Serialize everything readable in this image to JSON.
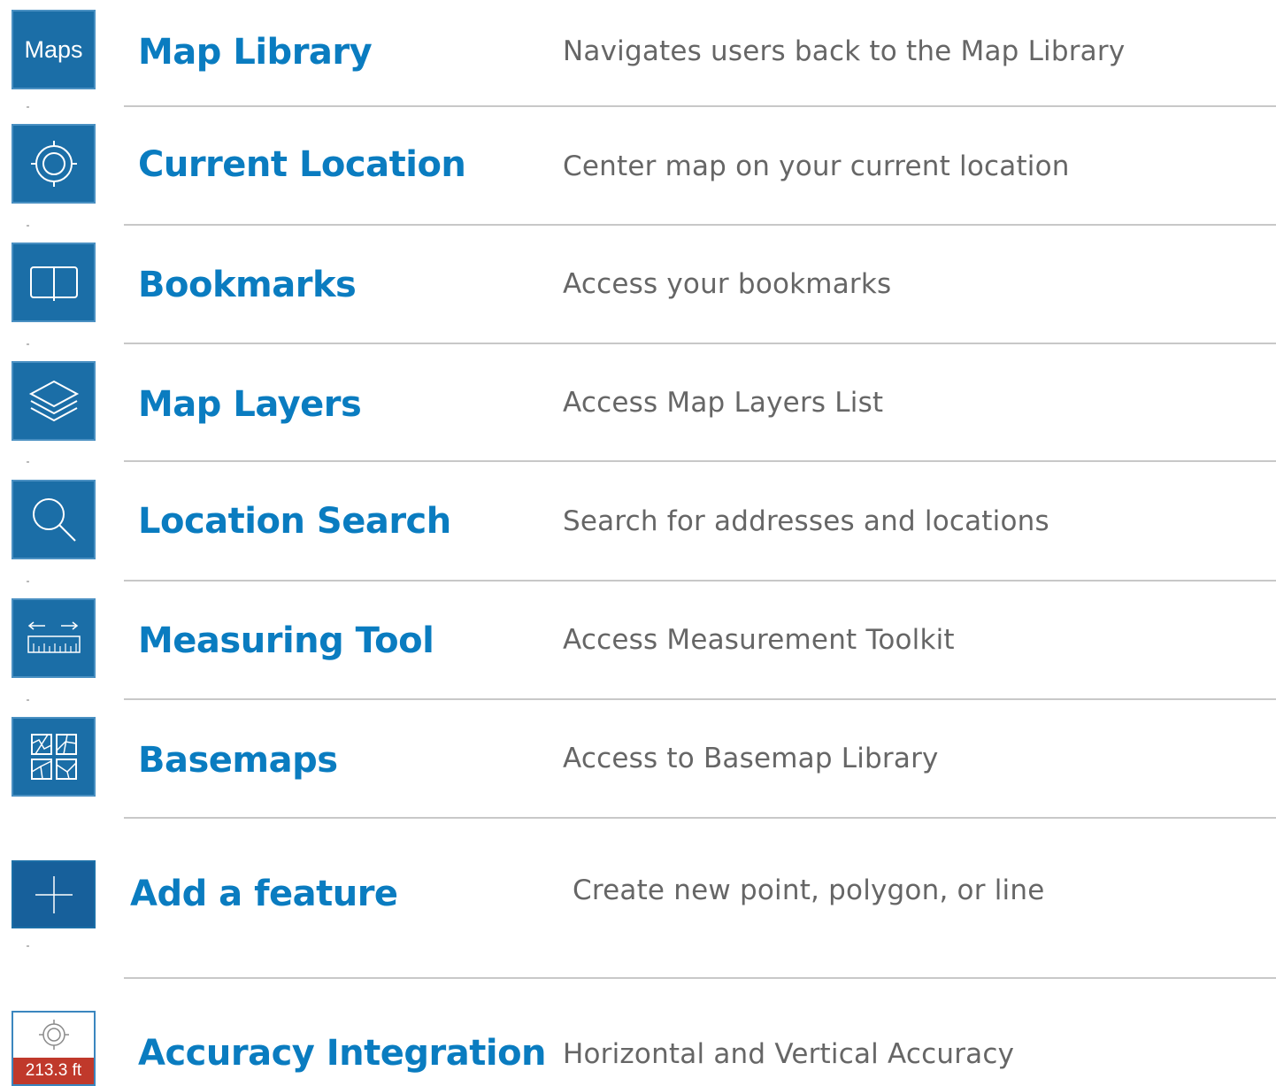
{
  "items": [
    {
      "icon": "maps-text-icon",
      "icon_text": "Maps",
      "title": "Map Library",
      "description": "Navigates users back to the Map Library"
    },
    {
      "icon": "crosshair-target-icon",
      "title": "Current Location",
      "description": "Center map on your current location"
    },
    {
      "icon": "open-book-icon",
      "title": "Bookmarks",
      "description": "Access your bookmarks"
    },
    {
      "icon": "layers-stack-icon",
      "title": "Map Layers",
      "description": "Access Map Layers List"
    },
    {
      "icon": "magnifier-search-icon",
      "title": "Location Search",
      "description": "Search for addresses and locations"
    },
    {
      "icon": "ruler-measure-icon",
      "title": "Measuring Tool",
      "description": "Access Measurement Toolkit"
    },
    {
      "icon": "basemap-grid-icon",
      "title": "Basemaps",
      "description": "Access to Basemap Library"
    },
    {
      "icon": "plus-add-icon",
      "title": "Add a feature",
      "description": "Create  new point,  polygon,  or line"
    },
    {
      "icon": "accuracy-target-icon",
      "icon_text": "213.3 ft",
      "title": "Accuracy  Integration",
      "description": "Horizontal  and  Vertical  Accuracy"
    }
  ],
  "colors": {
    "title_blue": "#0a7cc0",
    "icon_blue": "#1b6ea7",
    "description_gray": "#666666",
    "divider_gray": "#c8c8c8",
    "accuracy_red": "#c0392b"
  }
}
